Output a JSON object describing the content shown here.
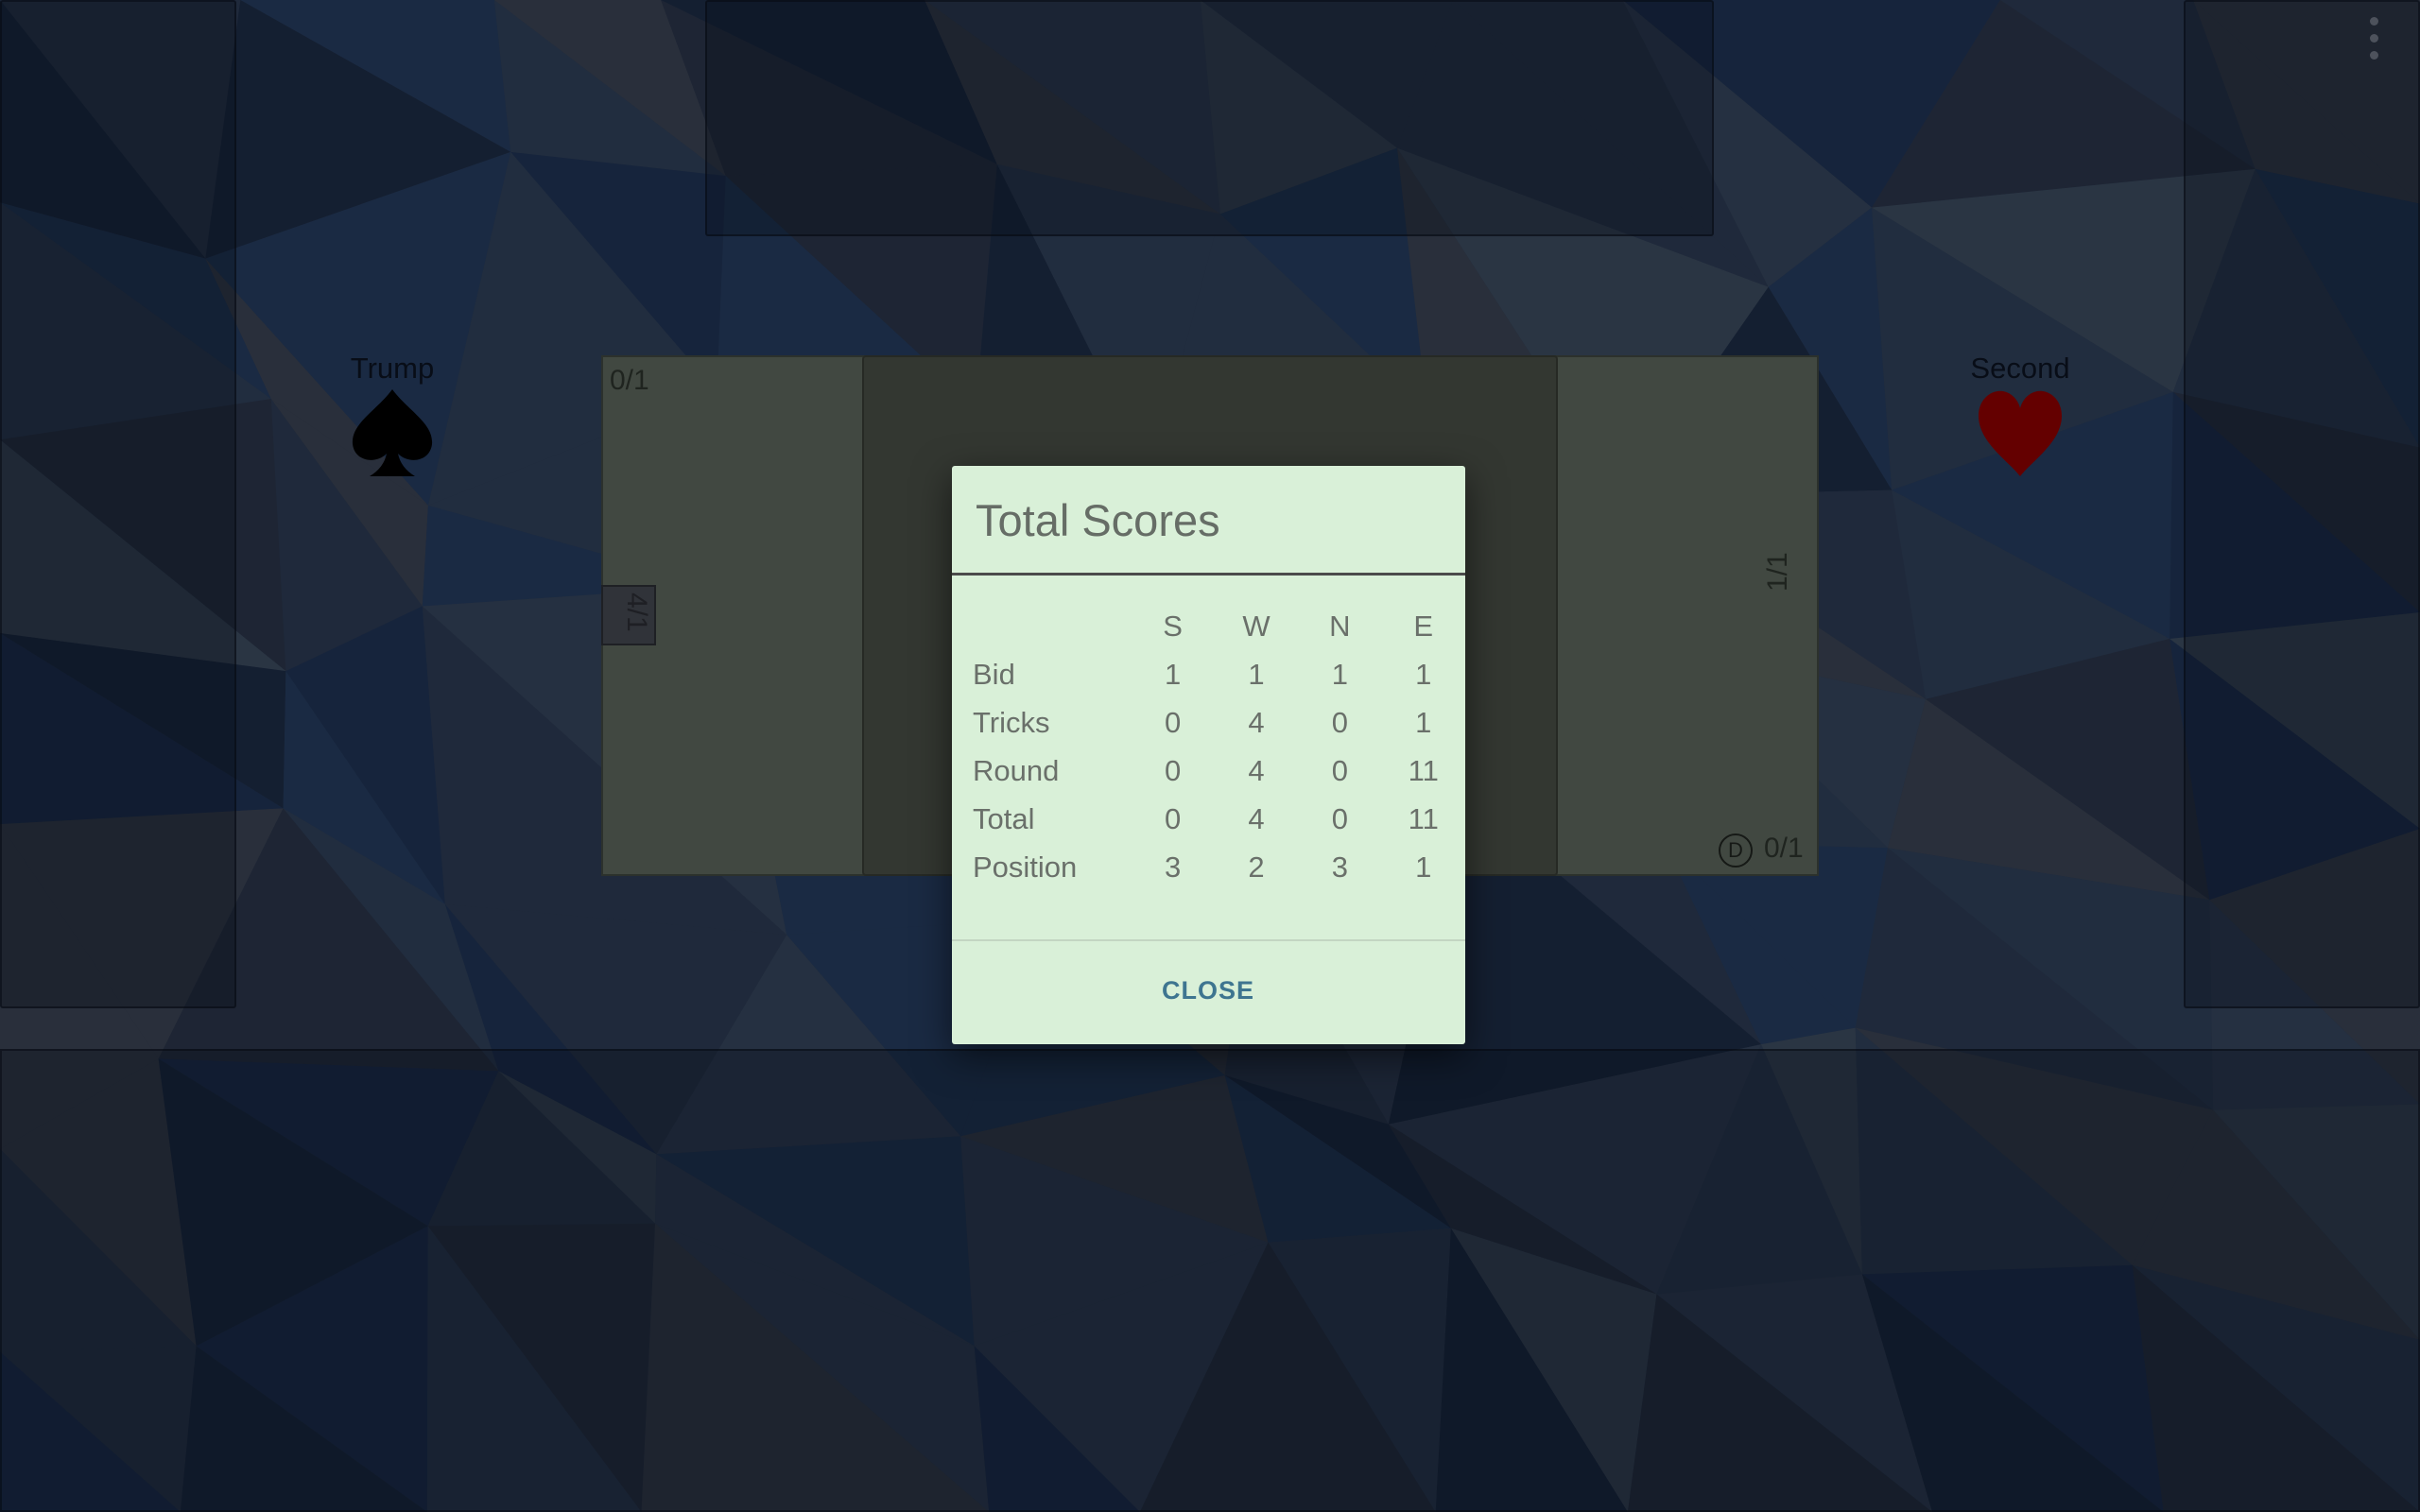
{
  "theme": {
    "background": "#2c3a52",
    "felt": "#5b655b",
    "trick_area": "#474d45",
    "dialog_bg": "#d9f0d8",
    "accent": "#3e7590",
    "heart_color": "#8b0000",
    "spade_color": "#000000"
  },
  "menu": {
    "icon": "more-vert-icon"
  },
  "trump": {
    "label": "Trump",
    "suit": "spade"
  },
  "second": {
    "label": "Second",
    "suit": "heart"
  },
  "table": {
    "north_score": "0/1",
    "west_score": "4/1",
    "east_score": "1/1",
    "south_score": "0/1",
    "dealer_marker": "D"
  },
  "dialog": {
    "title": "Total Scores",
    "columns": [
      "S",
      "W",
      "N",
      "E"
    ],
    "rows": [
      {
        "label": "Bid",
        "values": [
          "1",
          "1",
          "1",
          "1"
        ]
      },
      {
        "label": "Tricks",
        "values": [
          "0",
          "4",
          "0",
          "1"
        ]
      },
      {
        "label": "Round",
        "values": [
          "0",
          "4",
          "0",
          "11"
        ]
      },
      {
        "label": "Total",
        "values": [
          "0",
          "4",
          "0",
          "11"
        ]
      },
      {
        "label": "Position",
        "values": [
          "3",
          "2",
          "3",
          "1"
        ]
      }
    ],
    "close_label": "CLOSE"
  }
}
